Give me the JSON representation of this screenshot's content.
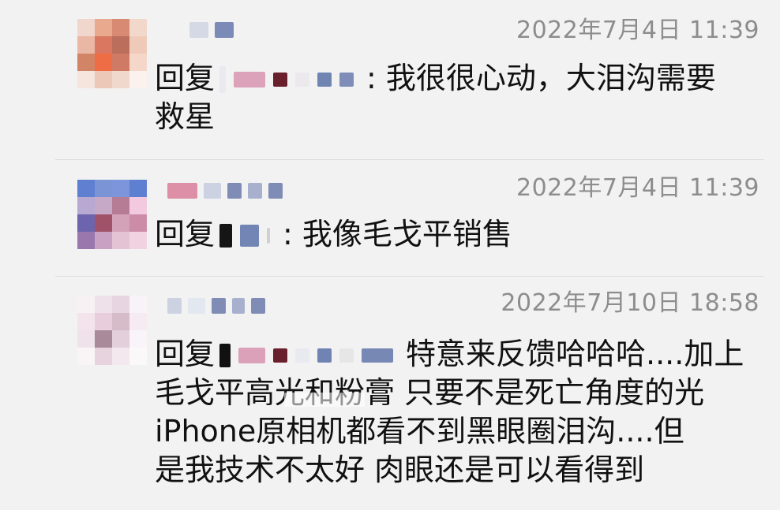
{
  "comments": [
    {
      "timestamp": "2022年7月4日 11:39",
      "reply_prefix": "回复",
      "reply_text_line1": ": 我很很心动，大泪沟需要",
      "reply_text_line2": "救星"
    },
    {
      "timestamp": "2022年7月4日 11:39",
      "reply_prefix": "回复",
      "reply_text_line1": ": 我像毛戈平销售"
    },
    {
      "timestamp": "2022年7月10日 18:58",
      "reply_prefix": "回复",
      "reply_text_line1": "特意来反馈哈哈哈....加上",
      "reply_text_line2": "毛戈平高光和粉膏 只要不是死亡角度的光",
      "reply_text_line3": "iPhone原相机都看不到黑眼圈泪沟....但",
      "reply_text_line4": "是我技术不太好 肉眼还是可以看得到"
    }
  ]
}
